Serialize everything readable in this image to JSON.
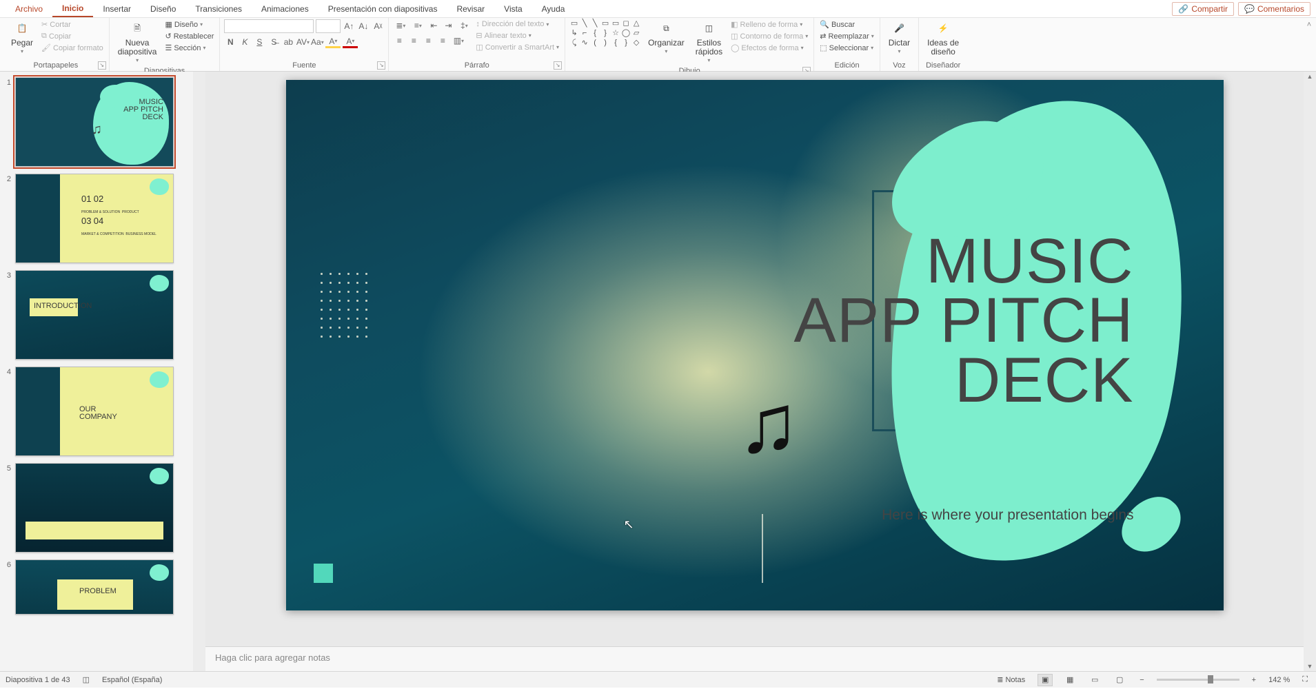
{
  "tabs": {
    "file": "Archivo",
    "home": "Inicio",
    "insert": "Insertar",
    "design": "Diseño",
    "transitions": "Transiciones",
    "animations": "Animaciones",
    "slideshow": "Presentación con diapositivas",
    "review": "Revisar",
    "view": "Vista",
    "help": "Ayuda",
    "share": "Compartir",
    "comments": "Comentarios"
  },
  "ribbon": {
    "clipboard": {
      "label": "Portapapeles",
      "paste": "Pegar",
      "cut": "Cortar",
      "copy": "Copiar",
      "formatPainter": "Copiar formato"
    },
    "slides": {
      "label": "Diapositivas",
      "newSlide": "Nueva\ndiapositiva",
      "layout": "Diseño",
      "reset": "Restablecer",
      "section": "Sección"
    },
    "font": {
      "label": "Fuente",
      "fontName": "",
      "fontSize": ""
    },
    "paragraph": {
      "label": "Párrafo",
      "textDir": "Dirección del texto",
      "alignText": "Alinear texto",
      "smartArt": "Convertir a SmartArt"
    },
    "drawing": {
      "label": "Dibujo",
      "arrange": "Organizar",
      "quickStyles": "Estilos\nrápidos",
      "fill": "Relleno de forma",
      "outline": "Contorno de forma",
      "effects": "Efectos de forma"
    },
    "editing": {
      "label": "Edición",
      "find": "Buscar",
      "replace": "Reemplazar",
      "select": "Seleccionar"
    },
    "voice": {
      "label": "Voz",
      "dictate": "Dictar"
    },
    "designer": {
      "label": "Diseñador",
      "ideas": "Ideas de\ndiseño"
    }
  },
  "slide": {
    "title_l1": "MUSIC",
    "title_l2": "APP PITCH",
    "title_l3": "DECK",
    "subtitle": "Here is where your presentation begins"
  },
  "thumbs": {
    "t1": "MUSIC\nAPP PITCH\nDECK",
    "t2_nums": [
      "01",
      "02",
      "03",
      "04"
    ],
    "t3": "INTRODUCTION",
    "t4": "OUR\nCOMPANY",
    "t6": "PROBLEM"
  },
  "notes": {
    "placeholder": "Haga clic para agregar notas"
  },
  "status": {
    "slideInfo": "Diapositiva 1 de 43",
    "language": "Español (España)",
    "notesBtn": "Notas",
    "zoom": "142 %"
  },
  "shapes_row1": [
    "▭",
    "╲",
    "╲",
    "▭",
    "▭",
    "◻",
    "△"
  ],
  "shapes_row2": [
    "↳",
    "⌐",
    "{",
    "}",
    "☆",
    "◯",
    "▱"
  ],
  "shapes_row3": [
    "⤹",
    "∿",
    "(",
    ")",
    "{",
    "}",
    "◇"
  ]
}
